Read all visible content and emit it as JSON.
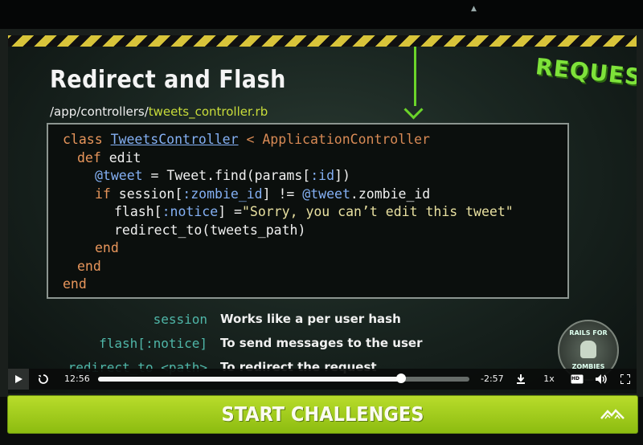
{
  "slide": {
    "title": "Redirect and Flash",
    "path_dir": "/app/controllers/",
    "path_file": "tweets_controller.rb",
    "badge": "REQUEST"
  },
  "code": {
    "l1_kw": "class",
    "l1_cls": "TweetsController",
    "l1_rest": " < ApplicationController",
    "l2_kw": "def",
    "l2_rest": " edit",
    "l3_ivar": "@tweet",
    "l3_rest": " = Tweet.find(params[",
    "l3_sym": ":id",
    "l3_end": "])",
    "l4_kw": "if",
    "l4_a": " session[",
    "l4_sym": ":zombie_id",
    "l4_b": "] != ",
    "l4_ivar": "@tweet",
    "l4_c": ".zombie_id",
    "l5_a": "flash[",
    "l5_sym": ":notice",
    "l5_b": "] =",
    "l5_str": "\"Sorry, you can’t edit this tweet\"",
    "l6": "redirect_to(tweets_path)",
    "l7": "end",
    "l8": "end",
    "l9": "end"
  },
  "definitions": [
    {
      "key": "session",
      "value": "Works like a per user hash"
    },
    {
      "key": "flash[:notice]",
      "value": "To send messages to the user"
    },
    {
      "key": "redirect_to <path>",
      "value": "To redirect the request"
    }
  ],
  "logo": {
    "top": "RAILS FOR",
    "bottom": "ZOMBIES"
  },
  "player": {
    "current_time": "12:56",
    "remaining_time": "-2:57",
    "speed": "1x",
    "progress": 0.817,
    "quality_badge": "HD",
    "icons": [
      "play-icon",
      "replay-icon",
      "download-icon",
      "quality-icon",
      "volume-icon",
      "fullscreen-icon"
    ]
  },
  "cta": {
    "label": "START CHALLENGES",
    "icon": "mountains-icon"
  },
  "colors": {
    "accent_green": "#8cbc10",
    "code_keyword": "#e7955b",
    "code_blue": "#84b0f4",
    "def_key": "#4fb6a8"
  }
}
